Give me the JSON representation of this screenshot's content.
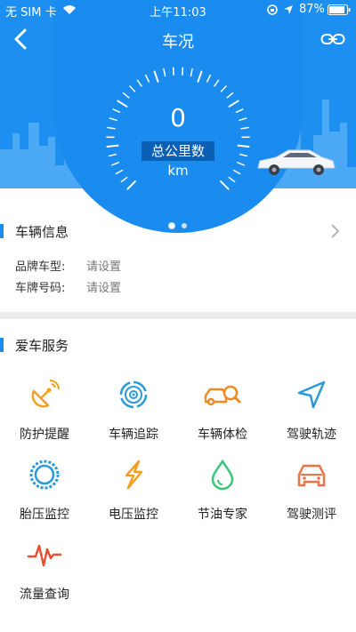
{
  "status": {
    "carrier": "无 SIM 卡",
    "time": "上午11:03",
    "battery": "87%"
  },
  "nav": {
    "title": "车况"
  },
  "gauge": {
    "value": "0",
    "label": "总公里数km"
  },
  "vehicle_info": {
    "title": "车辆信息",
    "rows": [
      {
        "label": "品牌车型:",
        "value": "请设置"
      },
      {
        "label": "车牌号码:",
        "value": "请设置"
      }
    ]
  },
  "services": {
    "title": "爱车服务",
    "items": [
      {
        "label": "防护提醒",
        "icon": "satellite-dish-icon",
        "color": "#f0a020"
      },
      {
        "label": "车辆追踪",
        "icon": "target-icon",
        "color": "#2a9ad8"
      },
      {
        "label": "车辆体检",
        "icon": "car-search-icon",
        "color": "#f08a20"
      },
      {
        "label": "驾驶轨迹",
        "icon": "navigation-arrow-icon",
        "color": "#2a9ad8"
      },
      {
        "label": "胎压监控",
        "icon": "tire-icon",
        "color": "#2a9ad8"
      },
      {
        "label": "电压监控",
        "icon": "lightning-icon",
        "color": "#f0a020"
      },
      {
        "label": "节油专家",
        "icon": "drop-icon",
        "color": "#3cc478"
      },
      {
        "label": "驾驶测评",
        "icon": "car-icon",
        "color": "#f07048"
      },
      {
        "label": "流量查询",
        "icon": "pulse-icon",
        "color": "#e85030"
      }
    ]
  }
}
